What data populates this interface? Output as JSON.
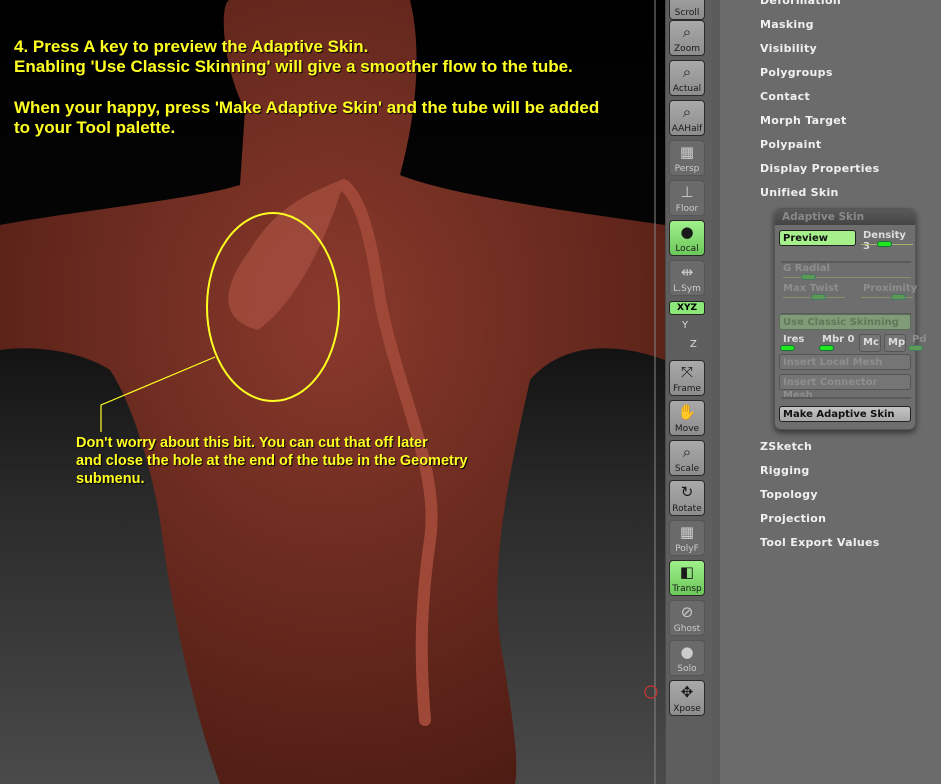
{
  "instructions": {
    "line1": "4. Press A key to preview the Adaptive Skin.",
    "line2": "Enabling 'Use Classic Skinning' will give a smoother flow to the tube.",
    "line3": "When your happy, press 'Make Adaptive Skin' and the tube will be added",
    "line4": "to your Tool palette."
  },
  "annotation": {
    "line1": "Don't worry about this bit. You can cut that off later",
    "line2": "and close the hole at the end of the tube in the Geometry",
    "line3": "submenu."
  },
  "toolbar": [
    {
      "label": "Scroll",
      "icon": "scroll-icon"
    },
    {
      "label": "Zoom",
      "icon": "zoom-icon"
    },
    {
      "label": "Actual",
      "icon": "actual-icon"
    },
    {
      "label": "AAHalf",
      "icon": "aahalf-icon"
    },
    {
      "label": "Persp",
      "icon": "perspective-grid-icon"
    },
    {
      "label": "Floor",
      "icon": "floor-icon"
    },
    {
      "label": "Local",
      "icon": "local-icon",
      "active": true
    },
    {
      "label": "L.Sym",
      "icon": "local-symmetry-icon"
    },
    {
      "label": "Frame",
      "icon": "frame-icon"
    },
    {
      "label": "Move",
      "icon": "move-hand-icon"
    },
    {
      "label": "Scale",
      "icon": "scale-icon"
    },
    {
      "label": "Rotate",
      "icon": "rotate-icon"
    },
    {
      "label": "PolyF",
      "icon": "polyframe-icon"
    },
    {
      "label": "Transp",
      "icon": "transparency-icon",
      "active": true
    },
    {
      "label": "Ghost",
      "icon": "ghost-icon"
    },
    {
      "label": "Solo",
      "icon": "solo-icon"
    },
    {
      "label": "Xpose",
      "icon": "xpose-icon"
    }
  ],
  "rotation_axes": {
    "xyz": "XYZ",
    "y": "Y",
    "z": "Z"
  },
  "menu_top": [
    "Deformation",
    "Masking",
    "Visibility",
    "Polygroups",
    "Contact",
    "Morph Target",
    "Polypaint",
    "Display Properties",
    "Unified Skin"
  ],
  "adaptive_skin": {
    "title": "Adaptive Skin",
    "preview": "Preview",
    "density": "Density 3",
    "density_value": 3,
    "g_radial": "G Radial",
    "max_twist": "Max Twist",
    "proximity": "Proximity",
    "use_classic": "Use Classic Skinning",
    "ires": "Ires",
    "mbr": "Mbr 0",
    "mc": "Mc",
    "mp": "Mp",
    "pd": "Pd",
    "insert_local": "Insert Local Mesh",
    "insert_connector": "Insert Connector Mesh",
    "make": "Make Adaptive Skin"
  },
  "menu_bottom": [
    "ZSketch",
    "Rigging",
    "Topology",
    "Projection",
    "Tool Export Values"
  ],
  "colors": {
    "highlight": "#ffff22",
    "active_button": "#a6f08c",
    "slider_knob": "#22e822"
  }
}
